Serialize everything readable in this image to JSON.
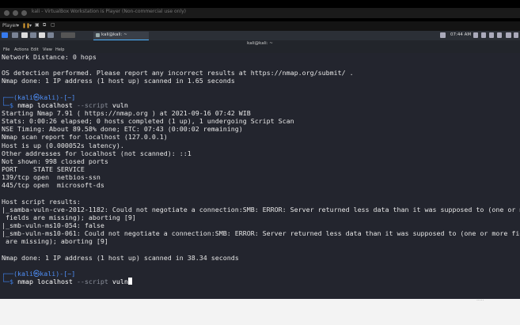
{
  "vm": {
    "title": "kali - VirtualBox Workstation is Player (Non-commercial use only)",
    "toolbar": {
      "player_label": "Player",
      "pause_symbol": "❚❚",
      "dropdown_symbol": "▾"
    }
  },
  "taskbar": {
    "task_label": "kali@kali: ~",
    "time": "07:44 AM"
  },
  "terminal": {
    "title": "kali@kali: ~",
    "menu": [
      "File",
      "Actions",
      "Edit",
      "View",
      "Help"
    ],
    "prompt_host": "(kali㉿kali)-[~]",
    "lines": [
      "Network Distance: 0 hops",
      "",
      "OS detection performed. Please report any incorrect results at https://nmap.org/submit/ .",
      "Nmap done: 1 IP address (1 host up) scanned in 1.65 seconds",
      "",
      "Starting Nmap 7.91 ( https://nmap.org ) at 2021-09-16 07:42 WIB",
      "Stats: 0:00:26 elapsed; 0 hosts completed (1 up), 1 undergoing Script Scan",
      "NSE Timing: About 89.58% done; ETC: 07:43 (0:00:02 remaining)",
      "Nmap scan report for localhost (127.0.0.1)",
      "Host is up (0.000052s latency).",
      "Other addresses for localhost (not scanned): ::1",
      "Not shown: 998 closed ports",
      "PORT    STATE SERVICE",
      "139/tcp open  netbios-ssn",
      "445/tcp open  microsoft-ds",
      "",
      "Host script results:",
      "|_samba-vuln-cve-2012-1182: Could not negotiate a connection:SMB: ERROR: Server returned less data than it was supposed to (one or more",
      " fields are missing); aborting [9]",
      "|_smb-vuln-ms10-054: false",
      "|_smb-vuln-ms10-061: Could not negotiate a connection:SMB: ERROR: Server returned less data than it was supposed to (one or more fields",
      " are missing); aborting [9]",
      "",
      "Nmap done: 1 IP address (1 host up) scanned in 38.34 seconds",
      ""
    ],
    "cmd1": {
      "program": "nmap",
      "target": "localhost",
      "option": "--script",
      "value": "vuln"
    },
    "cmd2": {
      "program": "nmap",
      "target": "localhost",
      "option": "--script",
      "value": "vuln"
    }
  }
}
